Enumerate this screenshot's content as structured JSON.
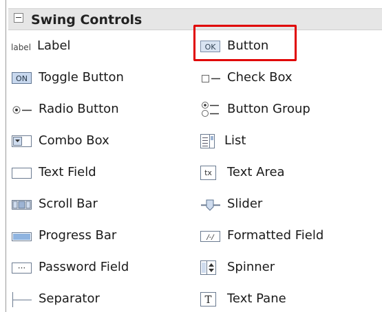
{
  "palette": {
    "title": "Swing Controls",
    "items": [
      {
        "label": "Label",
        "icon": "label-icon"
      },
      {
        "label": "Button",
        "icon": "button-icon"
      },
      {
        "label": "Toggle Button",
        "icon": "toggle-button-icon"
      },
      {
        "label": "Check Box",
        "icon": "check-box-icon"
      },
      {
        "label": "Radio Button",
        "icon": "radio-button-icon"
      },
      {
        "label": "Button Group",
        "icon": "button-group-icon"
      },
      {
        "label": "Combo Box",
        "icon": "combo-box-icon"
      },
      {
        "label": "List",
        "icon": "list-icon"
      },
      {
        "label": "Text Field",
        "icon": "text-field-icon"
      },
      {
        "label": "Text Area",
        "icon": "text-area-icon"
      },
      {
        "label": "Scroll Bar",
        "icon": "scroll-bar-icon"
      },
      {
        "label": "Slider",
        "icon": "slider-icon"
      },
      {
        "label": "Progress Bar",
        "icon": "progress-bar-icon"
      },
      {
        "label": "Formatted Field",
        "icon": "formatted-field-icon"
      },
      {
        "label": "Password Field",
        "icon": "password-field-icon"
      },
      {
        "label": "Spinner",
        "icon": "spinner-icon"
      },
      {
        "label": "Separator",
        "icon": "separator-icon"
      },
      {
        "label": "Text Pane",
        "icon": "text-pane-icon"
      }
    ],
    "icon_texts": {
      "label": "label",
      "button": "OK",
      "toggle": "ON",
      "text_area": "tx",
      "formatted": "/-/",
      "password": "···",
      "text_pane": "T"
    }
  },
  "colors": {
    "highlight": "#e00000",
    "header_bg": "#e6e6e6",
    "icon_blue": "#8fb4e0"
  }
}
